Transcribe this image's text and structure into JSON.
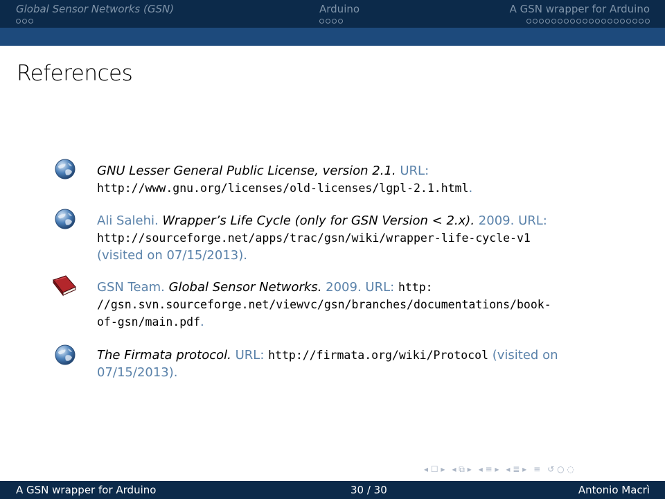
{
  "nav": {
    "sections": [
      {
        "label": "Global Sensor Networks (GSN)",
        "dots": 3
      },
      {
        "label": "Arduino",
        "dots": 4
      },
      {
        "label": "A GSN wrapper for Arduino",
        "dots": 20
      }
    ]
  },
  "slide": {
    "title": "References"
  },
  "references": [
    {
      "icon": "globe-icon",
      "title": "GNU Lesser General Public License, version 2.1.",
      "url_label": "URL:",
      "url": "http://www.gnu.org/licenses/old-licenses/lgpl-2.1.html",
      "end": "."
    },
    {
      "icon": "globe-icon",
      "author": "Ali Salehi.",
      "title": "Wrapper’s Life Cycle (only for GSN Version < 2.x).",
      "year": "2009.",
      "url_label": "URL:",
      "url": "http://sourceforge.net/apps/trac/gsn/wiki/wrapper-life-cycle-v1",
      "visited": "(visited on 07/15/2013)."
    },
    {
      "icon": "book-icon",
      "author": "GSN Team.",
      "title": "Global Sensor Networks.",
      "year": "2009.",
      "url_label": "URL:",
      "url_line1": "http:",
      "url_line2": "//gsn.svn.sourceforge.net/viewvc/gsn/branches/documentations/book-",
      "url_line3": "of-gsn/main.pdf",
      "end": "."
    },
    {
      "icon": "globe-icon",
      "title": "The Firmata protocol.",
      "url_label": "URL:",
      "url": "http://firmata.org/wiki/Protocol",
      "visited_line1": "(visited on",
      "visited_line2": "07/15/2013)."
    }
  ],
  "footer": {
    "left": "A GSN wrapper for Arduino",
    "center": "30 / 30",
    "right": "Antonio Macrì"
  },
  "colors": {
    "nav_dark": "#0c2a4a",
    "nav_mid": "#1d4a7c",
    "link_blue": "#5a82aa"
  }
}
